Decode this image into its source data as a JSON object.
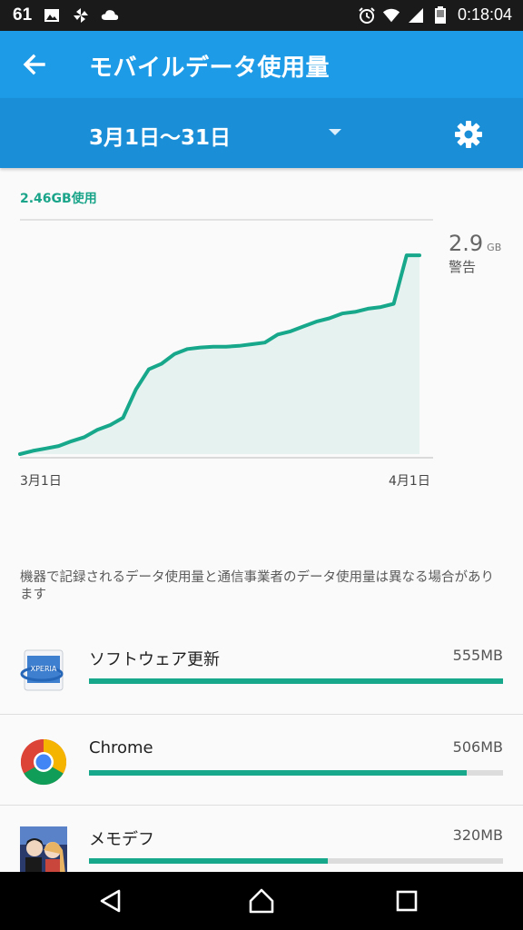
{
  "status_bar": {
    "notification_count": "61",
    "time": "0:18:04",
    "left_icons": [
      "image-icon",
      "pinwheel-icon",
      "cloud-icon"
    ],
    "right_icons": [
      "alarm-icon",
      "wifi-icon",
      "signal-icon",
      "battery-icon"
    ]
  },
  "app_bar": {
    "title": "モバイルデータ使用量",
    "back_icon": "arrow-left-icon",
    "color": "#1e9be6"
  },
  "filter_bar": {
    "period": "3月1日〜31日",
    "dropdown_icon": "caret-down-icon",
    "settings_icon": "gear-icon",
    "color": "#1a8fd8"
  },
  "usage_summary": {
    "used_label": "2.46GB使用",
    "accent_color": "#1aa58a"
  },
  "chart_data": {
    "type": "area",
    "x_start_label": "3月1日",
    "x_end_label": "4月1日",
    "x": [
      1,
      2,
      3,
      4,
      5,
      6,
      7,
      8,
      9,
      10,
      11,
      12,
      13,
      14,
      15,
      16,
      17,
      18,
      19,
      20,
      21,
      22,
      23,
      24,
      25,
      26,
      27,
      28,
      29,
      30,
      31,
      32
    ],
    "values": [
      0.0,
      0.04,
      0.07,
      0.1,
      0.16,
      0.21,
      0.3,
      0.36,
      0.45,
      0.8,
      1.05,
      1.12,
      1.24,
      1.3,
      1.32,
      1.33,
      1.33,
      1.34,
      1.36,
      1.38,
      1.48,
      1.52,
      1.58,
      1.64,
      1.68,
      1.74,
      1.76,
      1.8,
      1.82,
      1.86,
      2.46,
      2.46
    ],
    "ylim": [
      0,
      2.9
    ],
    "limit_value": "2.9",
    "limit_unit": "GB",
    "limit_label": "警告",
    "line_color": "#17a78a"
  },
  "disclaimer": "機器で記録されるデータ使用量と通信事業者のデータ使用量は異なる場合があります",
  "apps": [
    {
      "name": "ソフトウェア更新",
      "size": "555MB",
      "fraction": 1.0,
      "icon": "xperia-update-icon"
    },
    {
      "name": "Chrome",
      "size": "506MB",
      "fraction": 0.912,
      "icon": "chrome-icon"
    },
    {
      "name": "メモデフ",
      "size": "320MB",
      "fraction": 0.577,
      "icon": "game-character-icon"
    }
  ],
  "nav_bar": {
    "back_icon": "nav-back-icon",
    "home_icon": "nav-home-icon",
    "recents_icon": "nav-recents-icon"
  }
}
